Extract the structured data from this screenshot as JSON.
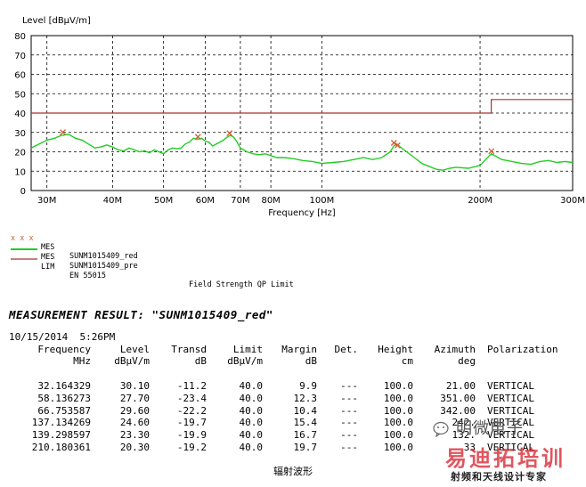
{
  "chart_data": {
    "type": "line",
    "ylabel": "Level [dBµV/m]",
    "xlabel": "Frequency [Hz]",
    "x_scale": "log",
    "ylim": [
      0,
      80
    ],
    "xlim_mhz": [
      28,
      300
    ],
    "y_ticks": [
      0,
      10,
      20,
      30,
      40,
      50,
      60,
      70,
      80
    ],
    "x_ticks": [
      {
        "mhz": 30,
        "label": "30M"
      },
      {
        "mhz": 40,
        "label": "40M"
      },
      {
        "mhz": 50,
        "label": "50M"
      },
      {
        "mhz": 60,
        "label": "60M"
      },
      {
        "mhz": 70,
        "label": "70M"
      },
      {
        "mhz": 80,
        "label": "80M"
      },
      {
        "mhz": 100,
        "label": "100M"
      },
      {
        "mhz": 200,
        "label": "200M"
      },
      {
        "mhz": 300,
        "label": "300M"
      }
    ],
    "grid": true,
    "series": [
      {
        "name": "SUNM1015409_pre",
        "color": "#22cc22",
        "points": [
          [
            28,
            22
          ],
          [
            29,
            24
          ],
          [
            30,
            26
          ],
          [
            31,
            27
          ],
          [
            32,
            28.5
          ],
          [
            33,
            29
          ],
          [
            34,
            27
          ],
          [
            35,
            26
          ],
          [
            36,
            24
          ],
          [
            37,
            22
          ],
          [
            38,
            22.5
          ],
          [
            39,
            23.5
          ],
          [
            40,
            22.5
          ],
          [
            41,
            21
          ],
          [
            42,
            20.5
          ],
          [
            43,
            22
          ],
          [
            44,
            21
          ],
          [
            45,
            20
          ],
          [
            46,
            20.5
          ],
          [
            47,
            19.5
          ],
          [
            48,
            21
          ],
          [
            49,
            20
          ],
          [
            50,
            19
          ],
          [
            51,
            21
          ],
          [
            52,
            22
          ],
          [
            53,
            21.5
          ],
          [
            54,
            22
          ],
          [
            55,
            24
          ],
          [
            56,
            25
          ],
          [
            57,
            27
          ],
          [
            58,
            26.5
          ],
          [
            59,
            27
          ],
          [
            60,
            25.5
          ],
          [
            61,
            25
          ],
          [
            62,
            23
          ],
          [
            63,
            24
          ],
          [
            64,
            25
          ],
          [
            65,
            26
          ],
          [
            66,
            27.5
          ],
          [
            67,
            28.5
          ],
          [
            68,
            27.5
          ],
          [
            69,
            25
          ],
          [
            70,
            22
          ],
          [
            72,
            20
          ],
          [
            74,
            19
          ],
          [
            76,
            18.5
          ],
          [
            78,
            19
          ],
          [
            80,
            18
          ],
          [
            82,
            17
          ],
          [
            85,
            17
          ],
          [
            88,
            16.5
          ],
          [
            92,
            15.5
          ],
          [
            96,
            15
          ],
          [
            100,
            14
          ],
          [
            105,
            14.5
          ],
          [
            110,
            15
          ],
          [
            115,
            16
          ],
          [
            120,
            17
          ],
          [
            125,
            16
          ],
          [
            130,
            17
          ],
          [
            135,
            20
          ],
          [
            137,
            23
          ],
          [
            139,
            24
          ],
          [
            141,
            22.5
          ],
          [
            145,
            20
          ],
          [
            150,
            17
          ],
          [
            155,
            14
          ],
          [
            160,
            12.5
          ],
          [
            165,
            11
          ],
          [
            170,
            10.5
          ],
          [
            175,
            11.5
          ],
          [
            180,
            12
          ],
          [
            190,
            11.5
          ],
          [
            200,
            13
          ],
          [
            205,
            16
          ],
          [
            210,
            19
          ],
          [
            215,
            17.5
          ],
          [
            220,
            16
          ],
          [
            230,
            15
          ],
          [
            240,
            14
          ],
          [
            250,
            13.5
          ],
          [
            260,
            15
          ],
          [
            270,
            15.5
          ],
          [
            280,
            14.5
          ],
          [
            290,
            15
          ],
          [
            300,
            14.5
          ]
        ]
      },
      {
        "name": "EN 55015",
        "color": "#a83232",
        "points": [
          [
            28,
            40
          ],
          [
            210,
            40
          ],
          [
            210,
            47
          ],
          [
            300,
            47
          ]
        ]
      }
    ],
    "markers": [
      {
        "name": "SUNM1015409_red",
        "color": "#d06030",
        "points": [
          [
            32.164329,
            30.1
          ],
          [
            58.136273,
            27.7
          ],
          [
            66.753587,
            29.6
          ],
          [
            137.134269,
            24.6
          ],
          [
            139.298597,
            23.3
          ],
          [
            210.180361,
            20.3
          ]
        ]
      }
    ],
    "legend": [
      {
        "symbol": "x x x",
        "tag": "MES",
        "name": "SUNM1015409_red",
        "desc": ""
      },
      {
        "symbol": "",
        "tag": "MES",
        "name": "SUNM1015409_pre",
        "desc": ""
      },
      {
        "symbol": "",
        "tag": "LIM",
        "name": "EN 55015",
        "desc": "Field Strength QP Limit"
      }
    ]
  },
  "result": {
    "title": "MEASUREMENT RESULT: \"SUNM1015409_red\"",
    "date": "10/15/2014  5:26PM",
    "headers": [
      [
        "Frequency",
        "MHz"
      ],
      [
        "Level",
        "dBµV/m"
      ],
      [
        "Transd",
        "dB"
      ],
      [
        "Limit",
        "dBµV/m"
      ],
      [
        "Margin",
        "dB"
      ],
      [
        "Det.",
        ""
      ],
      [
        "Height",
        "cm"
      ],
      [
        "Azimuth",
        "deg"
      ],
      [
        "Polarization",
        ""
      ]
    ],
    "rows": [
      [
        "32.164329",
        "30.10",
        "-11.2",
        "40.0",
        "9.9",
        "---",
        "100.0",
        "21.00",
        "VERTICAL"
      ],
      [
        "58.136273",
        "27.70",
        "-23.4",
        "40.0",
        "12.3",
        "---",
        "100.0",
        "351.00",
        "VERTICAL"
      ],
      [
        "66.753587",
        "29.60",
        "-22.2",
        "40.0",
        "10.4",
        "---",
        "100.0",
        "342.00",
        "VERTICAL"
      ],
      [
        "137.134269",
        "24.60",
        "-19.7",
        "40.0",
        "15.4",
        "---",
        "100.0",
        "242.",
        "VERTICAL"
      ],
      [
        "139.298597",
        "23.30",
        "-19.9",
        "40.0",
        "16.7",
        "---",
        "100.0",
        "132.",
        "VERTICAL"
      ],
      [
        "210.180361",
        "20.30",
        "-19.2",
        "40.0",
        "19.7",
        "---",
        "100.0",
        "33",
        "VERTICAL"
      ]
    ]
  },
  "caption": "辐射波形",
  "watermark": {
    "line1": "明微电子",
    "line2": "易迪拓培训",
    "line3": "射频和天线设计专家"
  }
}
